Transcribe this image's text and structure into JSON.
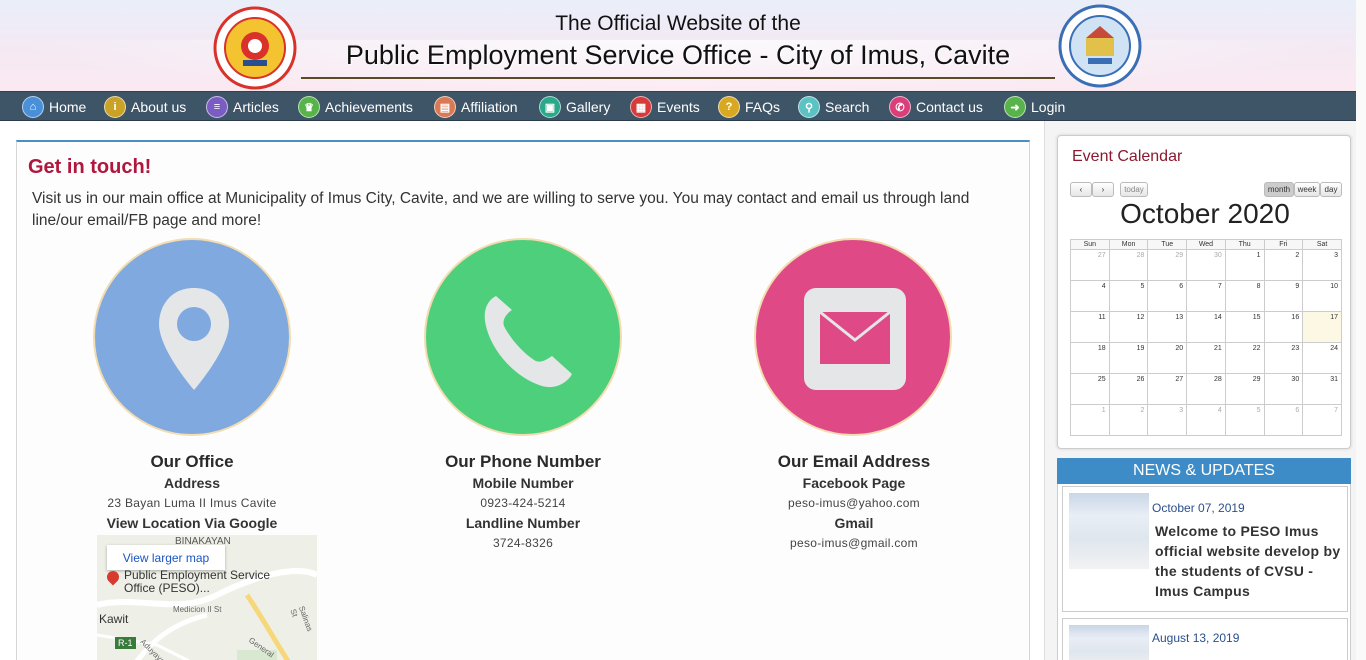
{
  "header": {
    "line1": "The Official Website of the",
    "line2": "Public Employment Service Office - City of Imus, Cavite",
    "left_logo_text": "PUBLIC EMPLOYMENT SERVICE OFFICE P.E.S.O.",
    "right_logo_text": "LUNGSOD NG IMUS LALAWIGAN NG CAVITE 2012"
  },
  "nav": {
    "items": [
      {
        "label": "Home",
        "icon": "home-icon",
        "color": "#4a90d9"
      },
      {
        "label": "About us",
        "icon": "info-icon",
        "color": "#c9a227"
      },
      {
        "label": "Articles",
        "icon": "articles-icon",
        "color": "#7b5cc4"
      },
      {
        "label": "Achievements",
        "icon": "trophy-icon",
        "color": "#58b34a"
      },
      {
        "label": "Affiliation",
        "icon": "affiliation-icon",
        "color": "#d97a55"
      },
      {
        "label": "Gallery",
        "icon": "gallery-icon",
        "color": "#2aa88a"
      },
      {
        "label": "Events",
        "icon": "calendar-icon",
        "color": "#d63a3a"
      },
      {
        "label": "FAQs",
        "icon": "question-icon",
        "color": "#d9a823"
      },
      {
        "label": "Search",
        "icon": "search-icon",
        "color": "#5cc2c2"
      },
      {
        "label": "Contact us",
        "icon": "phone-icon",
        "color": "#d9407a"
      },
      {
        "label": "Login",
        "icon": "login-icon",
        "color": "#58b34a"
      }
    ]
  },
  "main": {
    "title": "Get in touch!",
    "intro": "Visit us in our main office at Municipality of Imus City, Cavite, and we are willing to serve you. You may contact and email us through land line/our email/FB page and more!",
    "office": {
      "heading": "Our Office",
      "sub1": "Address",
      "val1": "23 Bayan Luma II Imus Cavite",
      "sub2": "View Location Via Google"
    },
    "phone": {
      "heading": "Our Phone Number",
      "sub1": "Mobile Number",
      "val1": "0923-424-5214",
      "sub2": "Landline Number",
      "val2": "3724-8326"
    },
    "email": {
      "heading": "Our Email Address",
      "sub1": "Facebook Page",
      "val1": "peso-imus@yahoo.com",
      "sub2": "Gmail",
      "val2": "peso-imus@gmail.com"
    },
    "map": {
      "button": "View larger map",
      "area": "BINAKAYAN",
      "place": "Public Employment Service Office (PESO)...",
      "town": "Kawit",
      "road": "R-1",
      "street1": "Medicion II St",
      "street2": "Salinas St",
      "street3": "Aduyaya",
      "street4": "General"
    },
    "colors": {
      "office": "#7fa9df",
      "phone": "#4ecf7b",
      "email": "#df4a86"
    }
  },
  "calendar": {
    "title": "Event Calendar",
    "prev": "‹",
    "next": "›",
    "today": "today",
    "views": [
      "month",
      "week",
      "day"
    ],
    "month": "October 2020",
    "weekdays": [
      "Sun",
      "Mon",
      "Tue",
      "Wed",
      "Thu",
      "Fri",
      "Sat"
    ],
    "weeks": [
      [
        "27",
        "28",
        "29",
        "30",
        "1",
        "2",
        "3"
      ],
      [
        "4",
        "5",
        "6",
        "7",
        "8",
        "9",
        "10"
      ],
      [
        "11",
        "12",
        "13",
        "14",
        "15",
        "16",
        "17"
      ],
      [
        "18",
        "19",
        "20",
        "21",
        "22",
        "23",
        "24"
      ],
      [
        "25",
        "26",
        "27",
        "28",
        "29",
        "30",
        "31"
      ],
      [
        "1",
        "2",
        "3",
        "4",
        "5",
        "6",
        "7"
      ]
    ]
  },
  "news": {
    "heading": "NEWS & UPDATES",
    "items": [
      {
        "date": "October 07, 2019",
        "title": "Welcome to PESO Imus official website develop by the students of CVSU - Imus Campus"
      },
      {
        "date": "August 13, 2019",
        "title": ""
      }
    ]
  }
}
